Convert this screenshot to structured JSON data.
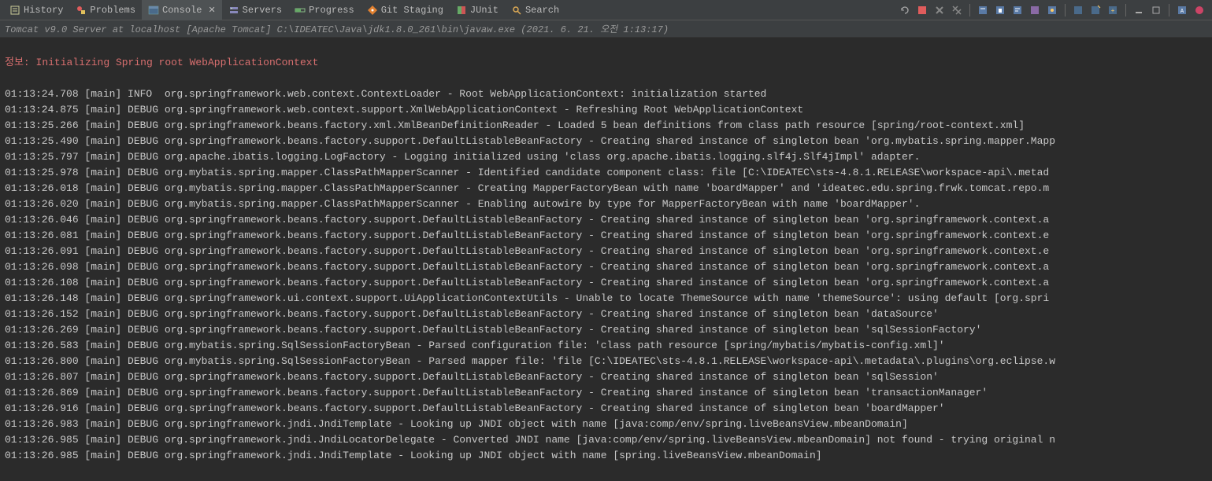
{
  "tabs": [
    {
      "label": "History"
    },
    {
      "label": "Problems"
    },
    {
      "label": "Console"
    },
    {
      "label": "Servers"
    },
    {
      "label": "Progress"
    },
    {
      "label": "Git Staging"
    },
    {
      "label": "JUnit"
    },
    {
      "label": "Search"
    }
  ],
  "subheader": "Tomcat v9.0 Server at localhost [Apache Tomcat] C:\\IDEATEC\\Java\\jdk1.8.0_261\\bin\\javaw.exe  (2021. 6. 21. 오전 1:13:17)",
  "info_prefix": "정보: ",
  "info_msg": "Initializing Spring root WebApplicationContext",
  "logs": [
    "01:13:24.708 [main] INFO  org.springframework.web.context.ContextLoader - Root WebApplicationContext: initialization started",
    "01:13:24.875 [main] DEBUG org.springframework.web.context.support.XmlWebApplicationContext - Refreshing Root WebApplicationContext",
    "01:13:25.266 [main] DEBUG org.springframework.beans.factory.xml.XmlBeanDefinitionReader - Loaded 5 bean definitions from class path resource [spring/root-context.xml]",
    "01:13:25.490 [main] DEBUG org.springframework.beans.factory.support.DefaultListableBeanFactory - Creating shared instance of singleton bean 'org.mybatis.spring.mapper.Mapp",
    "01:13:25.797 [main] DEBUG org.apache.ibatis.logging.LogFactory - Logging initialized using 'class org.apache.ibatis.logging.slf4j.Slf4jImpl' adapter.",
    "01:13:25.978 [main] DEBUG org.mybatis.spring.mapper.ClassPathMapperScanner - Identified candidate component class: file [C:\\IDEATEC\\sts-4.8.1.RELEASE\\workspace-api\\.metad",
    "01:13:26.018 [main] DEBUG org.mybatis.spring.mapper.ClassPathMapperScanner - Creating MapperFactoryBean with name 'boardMapper' and 'ideatec.edu.spring.frwk.tomcat.repo.m",
    "01:13:26.020 [main] DEBUG org.mybatis.spring.mapper.ClassPathMapperScanner - Enabling autowire by type for MapperFactoryBean with name 'boardMapper'.",
    "01:13:26.046 [main] DEBUG org.springframework.beans.factory.support.DefaultListableBeanFactory - Creating shared instance of singleton bean 'org.springframework.context.a",
    "01:13:26.081 [main] DEBUG org.springframework.beans.factory.support.DefaultListableBeanFactory - Creating shared instance of singleton bean 'org.springframework.context.e",
    "01:13:26.091 [main] DEBUG org.springframework.beans.factory.support.DefaultListableBeanFactory - Creating shared instance of singleton bean 'org.springframework.context.e",
    "01:13:26.098 [main] DEBUG org.springframework.beans.factory.support.DefaultListableBeanFactory - Creating shared instance of singleton bean 'org.springframework.context.a",
    "01:13:26.108 [main] DEBUG org.springframework.beans.factory.support.DefaultListableBeanFactory - Creating shared instance of singleton bean 'org.springframework.context.a",
    "01:13:26.148 [main] DEBUG org.springframework.ui.context.support.UiApplicationContextUtils - Unable to locate ThemeSource with name 'themeSource': using default [org.spri",
    "01:13:26.152 [main] DEBUG org.springframework.beans.factory.support.DefaultListableBeanFactory - Creating shared instance of singleton bean 'dataSource'",
    "01:13:26.269 [main] DEBUG org.springframework.beans.factory.support.DefaultListableBeanFactory - Creating shared instance of singleton bean 'sqlSessionFactory'",
    "01:13:26.583 [main] DEBUG org.mybatis.spring.SqlSessionFactoryBean - Parsed configuration file: 'class path resource [spring/mybatis/mybatis-config.xml]'",
    "01:13:26.800 [main] DEBUG org.mybatis.spring.SqlSessionFactoryBean - Parsed mapper file: 'file [C:\\IDEATEC\\sts-4.8.1.RELEASE\\workspace-api\\.metadata\\.plugins\\org.eclipse.w",
    "01:13:26.807 [main] DEBUG org.springframework.beans.factory.support.DefaultListableBeanFactory - Creating shared instance of singleton bean 'sqlSession'",
    "01:13:26.869 [main] DEBUG org.springframework.beans.factory.support.DefaultListableBeanFactory - Creating shared instance of singleton bean 'transactionManager'",
    "01:13:26.916 [main] DEBUG org.springframework.beans.factory.support.DefaultListableBeanFactory - Creating shared instance of singleton bean 'boardMapper'",
    "01:13:26.983 [main] DEBUG org.springframework.jndi.JndiTemplate - Looking up JNDI object with name [java:comp/env/spring.liveBeansView.mbeanDomain]",
    "01:13:26.985 [main] DEBUG org.springframework.jndi.JndiLocatorDelegate - Converted JNDI name [java:comp/env/spring.liveBeansView.mbeanDomain] not found - trying original n",
    "01:13:26.985 [main] DEBUG org.springframework.jndi.JndiTemplate - Looking up JNDI object with name [spring.liveBeansView.mbeanDomain]"
  ]
}
